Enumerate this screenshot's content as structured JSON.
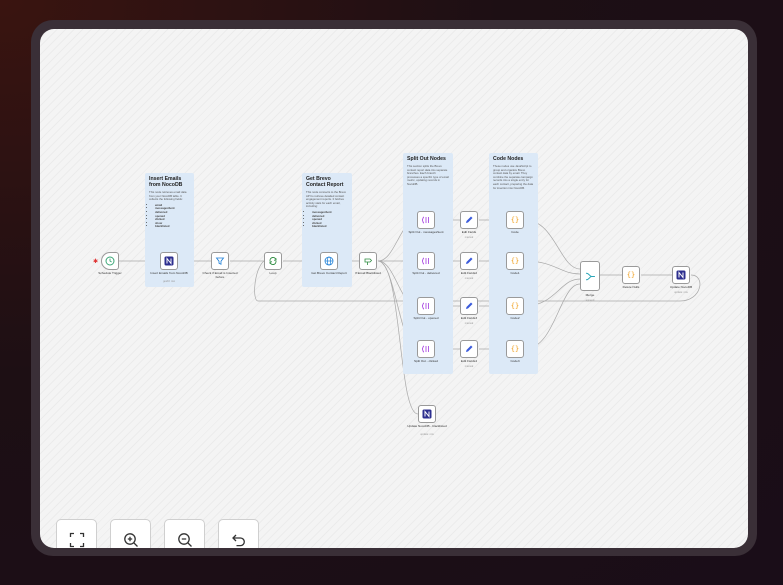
{
  "notes": {
    "insert": {
      "title": "Insert Emails from NocoDB",
      "body": "This node retrieves email data from your NocoDB table. It collects the following fields:",
      "fields": [
        "email",
        "messagesSent",
        "delivered",
        "opened",
        "clicked",
        "show",
        "blacklisted"
      ]
    },
    "brevo": {
      "title": "Get Brevo Contact Report",
      "body": "This node connects to the Brevo API to retrieve detailed contact engagement reports. It fetches activity stats for each email, including:",
      "fields": [
        "messagesSent",
        "delivered",
        "opened",
        "clicked",
        "blacklisted"
      ]
    },
    "split": {
      "title": "Split Out Nodes",
      "body": "This section splits the Brevo contact report data into separate branches. Each branch processes a specific type of email metric, updating records in NocoDB."
    },
    "code": {
      "title": "Code Nodes",
      "body": "These nodes use JavaScript to group and organize Brevo contact data by email. They combine the separate campaign records into a single entry for each contact, preparing the data for insertion into NocoDB."
    }
  },
  "nodes": {
    "scheduler": {
      "label": "Schedule Trigger"
    },
    "insert_emails": {
      "label": "Insert Emails from NocoDB",
      "sub": "getAll: row"
    },
    "check_email": {
      "label": "Check if Email is Inserted before"
    },
    "loop": {
      "label": "Loop"
    },
    "get_brevo": {
      "label": "Get Brevo Contact Report"
    },
    "if_blacklisted": {
      "label": "If Email Blacklisted"
    },
    "split_sent": {
      "label": "Split Out - messagesSent"
    },
    "split_delivered": {
      "label": "Split Out - delivered"
    },
    "split_opened": {
      "label": "Split Out - opened"
    },
    "split_clicked": {
      "label": "Split Out - clicked"
    },
    "edit_fields": {
      "label": "Edit Fields",
      "sub": "manual"
    },
    "edit_fields2": {
      "label": "Edit Fields2",
      "sub": "manual"
    },
    "edit_fields3": {
      "label": "Edit Fields3",
      "sub": "manual"
    },
    "edit_fields4": {
      "label": "Edit Fields4",
      "sub": "manual"
    },
    "code": {
      "label": "Code"
    },
    "code1": {
      "label": "Code1"
    },
    "code2": {
      "label": "Code2"
    },
    "code3": {
      "label": "Code3"
    },
    "merge": {
      "label": "Merge",
      "sub": "append"
    },
    "delete_nulls": {
      "label": "Delete Nulls"
    },
    "update_nocodb": {
      "label": "Update NocoDB",
      "sub": "update: row"
    },
    "update_blacklisted": {
      "label": "Update NocoDB - blacklisted",
      "sub": "update: row"
    }
  },
  "controls": {
    "fit": "fit-view",
    "zoom_in": "zoom-in",
    "zoom_out": "zoom-out",
    "reset": "reset-zoom"
  },
  "colors": {
    "note_bg": "#dce9f7",
    "nocodb": "#2d2f8f",
    "trigger": "#3aa676",
    "set": "#3b5bdb",
    "code": "#f0a020",
    "split": "#a23ae0",
    "merge": "#2ba6b8"
  }
}
